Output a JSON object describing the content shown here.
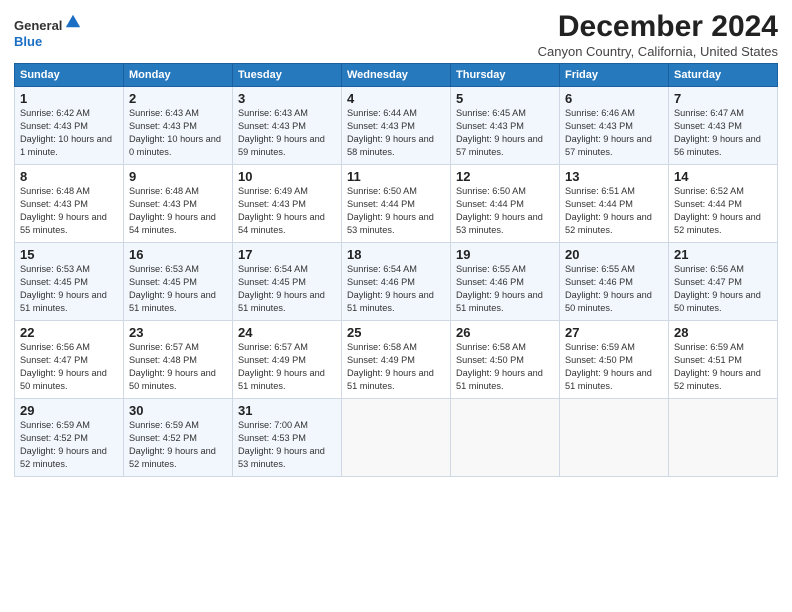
{
  "logo": {
    "general": "General",
    "blue": "Blue"
  },
  "title": "December 2024",
  "subtitle": "Canyon Country, California, United States",
  "headers": [
    "Sunday",
    "Monday",
    "Tuesday",
    "Wednesday",
    "Thursday",
    "Friday",
    "Saturday"
  ],
  "weeks": [
    [
      {
        "day": "1",
        "sunrise": "Sunrise: 6:42 AM",
        "sunset": "Sunset: 4:43 PM",
        "daylight": "Daylight: 10 hours and 1 minute."
      },
      {
        "day": "2",
        "sunrise": "Sunrise: 6:43 AM",
        "sunset": "Sunset: 4:43 PM",
        "daylight": "Daylight: 10 hours and 0 minutes."
      },
      {
        "day": "3",
        "sunrise": "Sunrise: 6:43 AM",
        "sunset": "Sunset: 4:43 PM",
        "daylight": "Daylight: 9 hours and 59 minutes."
      },
      {
        "day": "4",
        "sunrise": "Sunrise: 6:44 AM",
        "sunset": "Sunset: 4:43 PM",
        "daylight": "Daylight: 9 hours and 58 minutes."
      },
      {
        "day": "5",
        "sunrise": "Sunrise: 6:45 AM",
        "sunset": "Sunset: 4:43 PM",
        "daylight": "Daylight: 9 hours and 57 minutes."
      },
      {
        "day": "6",
        "sunrise": "Sunrise: 6:46 AM",
        "sunset": "Sunset: 4:43 PM",
        "daylight": "Daylight: 9 hours and 57 minutes."
      },
      {
        "day": "7",
        "sunrise": "Sunrise: 6:47 AM",
        "sunset": "Sunset: 4:43 PM",
        "daylight": "Daylight: 9 hours and 56 minutes."
      }
    ],
    [
      {
        "day": "8",
        "sunrise": "Sunrise: 6:48 AM",
        "sunset": "Sunset: 4:43 PM",
        "daylight": "Daylight: 9 hours and 55 minutes."
      },
      {
        "day": "9",
        "sunrise": "Sunrise: 6:48 AM",
        "sunset": "Sunset: 4:43 PM",
        "daylight": "Daylight: 9 hours and 54 minutes."
      },
      {
        "day": "10",
        "sunrise": "Sunrise: 6:49 AM",
        "sunset": "Sunset: 4:43 PM",
        "daylight": "Daylight: 9 hours and 54 minutes."
      },
      {
        "day": "11",
        "sunrise": "Sunrise: 6:50 AM",
        "sunset": "Sunset: 4:44 PM",
        "daylight": "Daylight: 9 hours and 53 minutes."
      },
      {
        "day": "12",
        "sunrise": "Sunrise: 6:50 AM",
        "sunset": "Sunset: 4:44 PM",
        "daylight": "Daylight: 9 hours and 53 minutes."
      },
      {
        "day": "13",
        "sunrise": "Sunrise: 6:51 AM",
        "sunset": "Sunset: 4:44 PM",
        "daylight": "Daylight: 9 hours and 52 minutes."
      },
      {
        "day": "14",
        "sunrise": "Sunrise: 6:52 AM",
        "sunset": "Sunset: 4:44 PM",
        "daylight": "Daylight: 9 hours and 52 minutes."
      }
    ],
    [
      {
        "day": "15",
        "sunrise": "Sunrise: 6:53 AM",
        "sunset": "Sunset: 4:45 PM",
        "daylight": "Daylight: 9 hours and 51 minutes."
      },
      {
        "day": "16",
        "sunrise": "Sunrise: 6:53 AM",
        "sunset": "Sunset: 4:45 PM",
        "daylight": "Daylight: 9 hours and 51 minutes."
      },
      {
        "day": "17",
        "sunrise": "Sunrise: 6:54 AM",
        "sunset": "Sunset: 4:45 PM",
        "daylight": "Daylight: 9 hours and 51 minutes."
      },
      {
        "day": "18",
        "sunrise": "Sunrise: 6:54 AM",
        "sunset": "Sunset: 4:46 PM",
        "daylight": "Daylight: 9 hours and 51 minutes."
      },
      {
        "day": "19",
        "sunrise": "Sunrise: 6:55 AM",
        "sunset": "Sunset: 4:46 PM",
        "daylight": "Daylight: 9 hours and 51 minutes."
      },
      {
        "day": "20",
        "sunrise": "Sunrise: 6:55 AM",
        "sunset": "Sunset: 4:46 PM",
        "daylight": "Daylight: 9 hours and 50 minutes."
      },
      {
        "day": "21",
        "sunrise": "Sunrise: 6:56 AM",
        "sunset": "Sunset: 4:47 PM",
        "daylight": "Daylight: 9 hours and 50 minutes."
      }
    ],
    [
      {
        "day": "22",
        "sunrise": "Sunrise: 6:56 AM",
        "sunset": "Sunset: 4:47 PM",
        "daylight": "Daylight: 9 hours and 50 minutes."
      },
      {
        "day": "23",
        "sunrise": "Sunrise: 6:57 AM",
        "sunset": "Sunset: 4:48 PM",
        "daylight": "Daylight: 9 hours and 50 minutes."
      },
      {
        "day": "24",
        "sunrise": "Sunrise: 6:57 AM",
        "sunset": "Sunset: 4:49 PM",
        "daylight": "Daylight: 9 hours and 51 minutes."
      },
      {
        "day": "25",
        "sunrise": "Sunrise: 6:58 AM",
        "sunset": "Sunset: 4:49 PM",
        "daylight": "Daylight: 9 hours and 51 minutes."
      },
      {
        "day": "26",
        "sunrise": "Sunrise: 6:58 AM",
        "sunset": "Sunset: 4:50 PM",
        "daylight": "Daylight: 9 hours and 51 minutes."
      },
      {
        "day": "27",
        "sunrise": "Sunrise: 6:59 AM",
        "sunset": "Sunset: 4:50 PM",
        "daylight": "Daylight: 9 hours and 51 minutes."
      },
      {
        "day": "28",
        "sunrise": "Sunrise: 6:59 AM",
        "sunset": "Sunset: 4:51 PM",
        "daylight": "Daylight: 9 hours and 52 minutes."
      }
    ],
    [
      {
        "day": "29",
        "sunrise": "Sunrise: 6:59 AM",
        "sunset": "Sunset: 4:52 PM",
        "daylight": "Daylight: 9 hours and 52 minutes."
      },
      {
        "day": "30",
        "sunrise": "Sunrise: 6:59 AM",
        "sunset": "Sunset: 4:52 PM",
        "daylight": "Daylight: 9 hours and 52 minutes."
      },
      {
        "day": "31",
        "sunrise": "Sunrise: 7:00 AM",
        "sunset": "Sunset: 4:53 PM",
        "daylight": "Daylight: 9 hours and 53 minutes."
      },
      null,
      null,
      null,
      null
    ]
  ]
}
